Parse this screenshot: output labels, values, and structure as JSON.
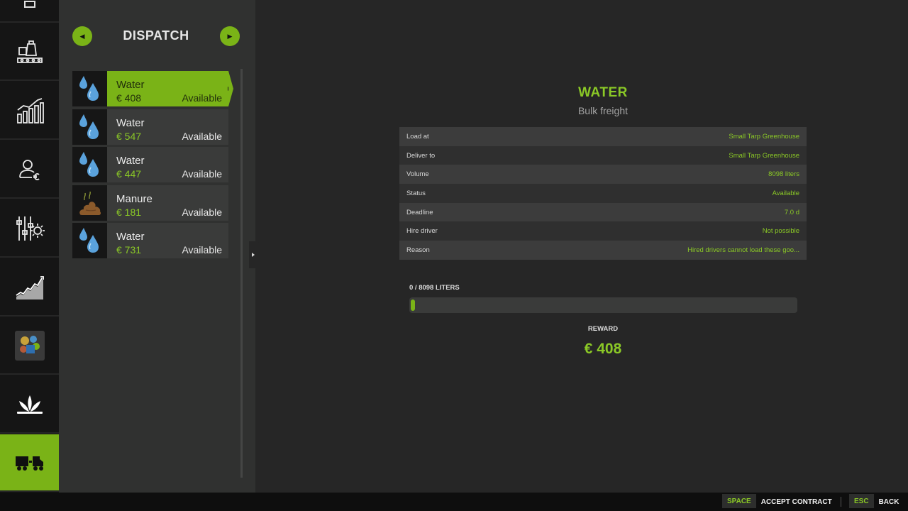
{
  "colors": {
    "accent": "#7ab317",
    "accent_text": "#8bc926",
    "background": "#262626",
    "rail": "#151515",
    "panel": "#303130"
  },
  "rail": {
    "items": [
      {
        "name": "rail-item-partial",
        "icon": "document-icon",
        "active": false
      },
      {
        "name": "rail-item-production",
        "icon": "factory-conveyor-icon",
        "active": false
      },
      {
        "name": "rail-item-statistics",
        "icon": "bar-chart-icon",
        "active": false
      },
      {
        "name": "rail-item-finances",
        "icon": "person-euro-icon",
        "active": false
      },
      {
        "name": "rail-item-settings",
        "icon": "sliders-gear-icon",
        "active": false
      },
      {
        "name": "rail-item-prices",
        "icon": "trend-chart-icon",
        "active": false
      },
      {
        "name": "rail-item-map",
        "icon": "map-thumbnail-icon",
        "active": false
      },
      {
        "name": "rail-item-crops",
        "icon": "plant-icon",
        "active": false
      },
      {
        "name": "rail-item-dispatch",
        "icon": "truck-trailer-icon",
        "active": true
      }
    ]
  },
  "panel": {
    "title": "DISPATCH",
    "prev_icon": "arrow-left-icon",
    "next_icon": "arrow-right-icon"
  },
  "contracts": [
    {
      "name": "Water",
      "price": "€ 408",
      "status": "Available",
      "icon": "water-drops-icon",
      "selected": true
    },
    {
      "name": "Water",
      "price": "€ 547",
      "status": "Available",
      "icon": "water-drops-icon",
      "selected": false
    },
    {
      "name": "Water",
      "price": "€ 447",
      "status": "Available",
      "icon": "water-drops-icon",
      "selected": false
    },
    {
      "name": "Manure",
      "price": "€ 181",
      "status": "Available",
      "icon": "manure-icon",
      "selected": false
    },
    {
      "name": "Water",
      "price": "€ 731",
      "status": "Available",
      "icon": "water-drops-icon",
      "selected": false
    }
  ],
  "detail": {
    "title": "WATER",
    "subtitle": "Bulk freight",
    "rows": [
      {
        "label": "Load at",
        "value": "Small Tarp Greenhouse"
      },
      {
        "label": "Deliver to",
        "value": "Small Tarp Greenhouse"
      },
      {
        "label": "Volume",
        "value": "8098 liters"
      },
      {
        "label": "Status",
        "value": "Available"
      },
      {
        "label": "Deadline",
        "value": "7.0 d"
      },
      {
        "label": "Hire driver",
        "value": "Not possible"
      },
      {
        "label": "Reason",
        "value": "Hired drivers cannot load these goo..."
      }
    ],
    "progress_label": "0 / 8098 LITERS",
    "progress_fraction": 0,
    "reward_label": "REWARD",
    "reward_value": "€ 408"
  },
  "footer": {
    "accept_key": "SPACE",
    "accept_label": "ACCEPT CONTRACT",
    "back_key": "ESC",
    "back_label": "BACK"
  }
}
